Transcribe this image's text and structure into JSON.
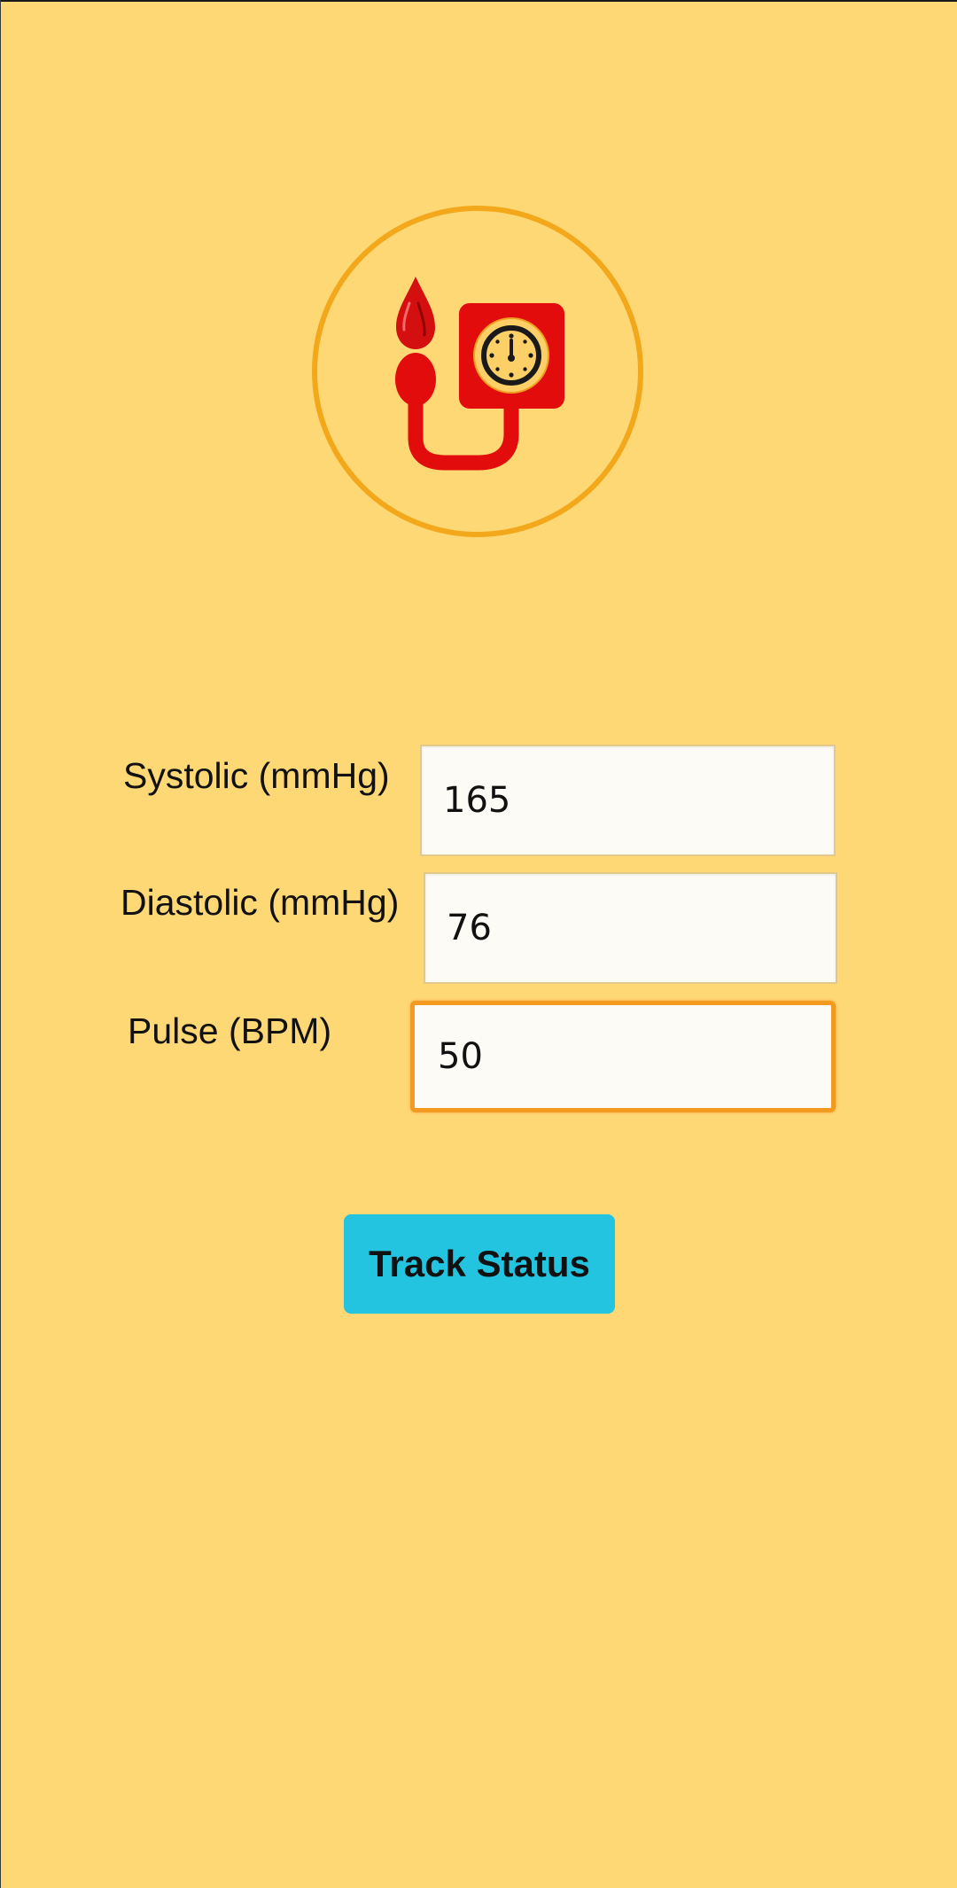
{
  "app": {
    "background_color": "#ffd876",
    "accent_color": "#f2a81a",
    "logo_icon": "blood-pressure-monitor-icon"
  },
  "form": {
    "systolic": {
      "label": "Systolic (mmHg)",
      "value": "165"
    },
    "diastolic": {
      "label": "Diastolic (mmHg)",
      "value": "76"
    },
    "pulse": {
      "label": "Pulse (BPM)",
      "value": "50"
    },
    "submit_label": "Track Status",
    "submit_color": "#22c4e0"
  }
}
